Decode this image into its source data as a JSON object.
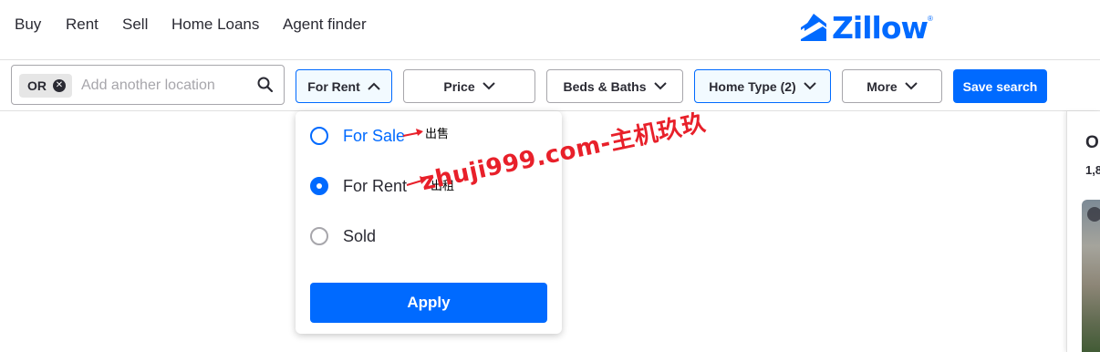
{
  "nav": {
    "links": [
      "Buy",
      "Rent",
      "Sell",
      "Home Loans",
      "Agent finder"
    ],
    "logo_text": "Zillow",
    "logo_mark": "®"
  },
  "search": {
    "chip_label": "OR",
    "placeholder": "Add another location",
    "value": ""
  },
  "filters": {
    "listing_type": "For Rent",
    "price": "Price",
    "beds_baths": "Beds & Baths",
    "home_type": "Home Type (2)",
    "more": "More",
    "save_search": "Save search"
  },
  "dropdown": {
    "options": [
      {
        "label": "For Sale",
        "state": "hover"
      },
      {
        "label": "For Rent",
        "state": "selected"
      },
      {
        "label": "Sold",
        "state": "unselected"
      }
    ],
    "apply": "Apply"
  },
  "annotations": {
    "for_sale_note": "出售",
    "for_rent_note": "出租",
    "watermark": "zhuji999.com-主机玖玖"
  },
  "right_panel": {
    "title_partial": "O",
    "count_partial": "1,8"
  },
  "colors": {
    "brand": "#006aff",
    "annotation": "#e8202a"
  }
}
